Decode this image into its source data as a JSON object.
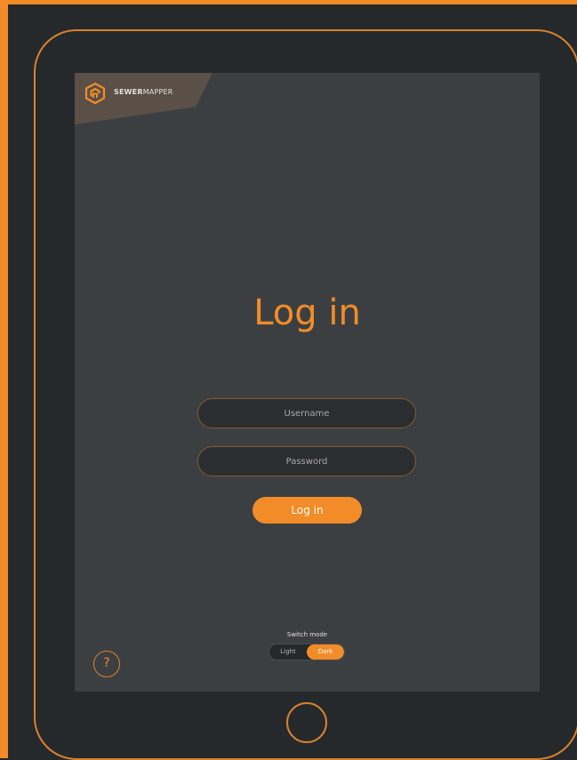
{
  "brand": {
    "name_bold": "SEWER",
    "name_light": "MAPPER",
    "logo_icon": "sewermapper-logo-icon"
  },
  "login": {
    "title": "Log in",
    "username_placeholder": "Username",
    "password_placeholder": "Password",
    "submit_label": "Log in"
  },
  "mode_switch": {
    "label": "Switch mode",
    "options": [
      "Light",
      "Dark"
    ],
    "selected": "Dark"
  },
  "help": {
    "label": "?",
    "icon": "help-icon"
  },
  "device": {
    "home_button_icon": "home-button-icon"
  },
  "colors": {
    "accent": "#f28c28",
    "screen_bg": "#3b3f41",
    "device_bg": "#25292b",
    "field_bg": "#2a2e30"
  }
}
